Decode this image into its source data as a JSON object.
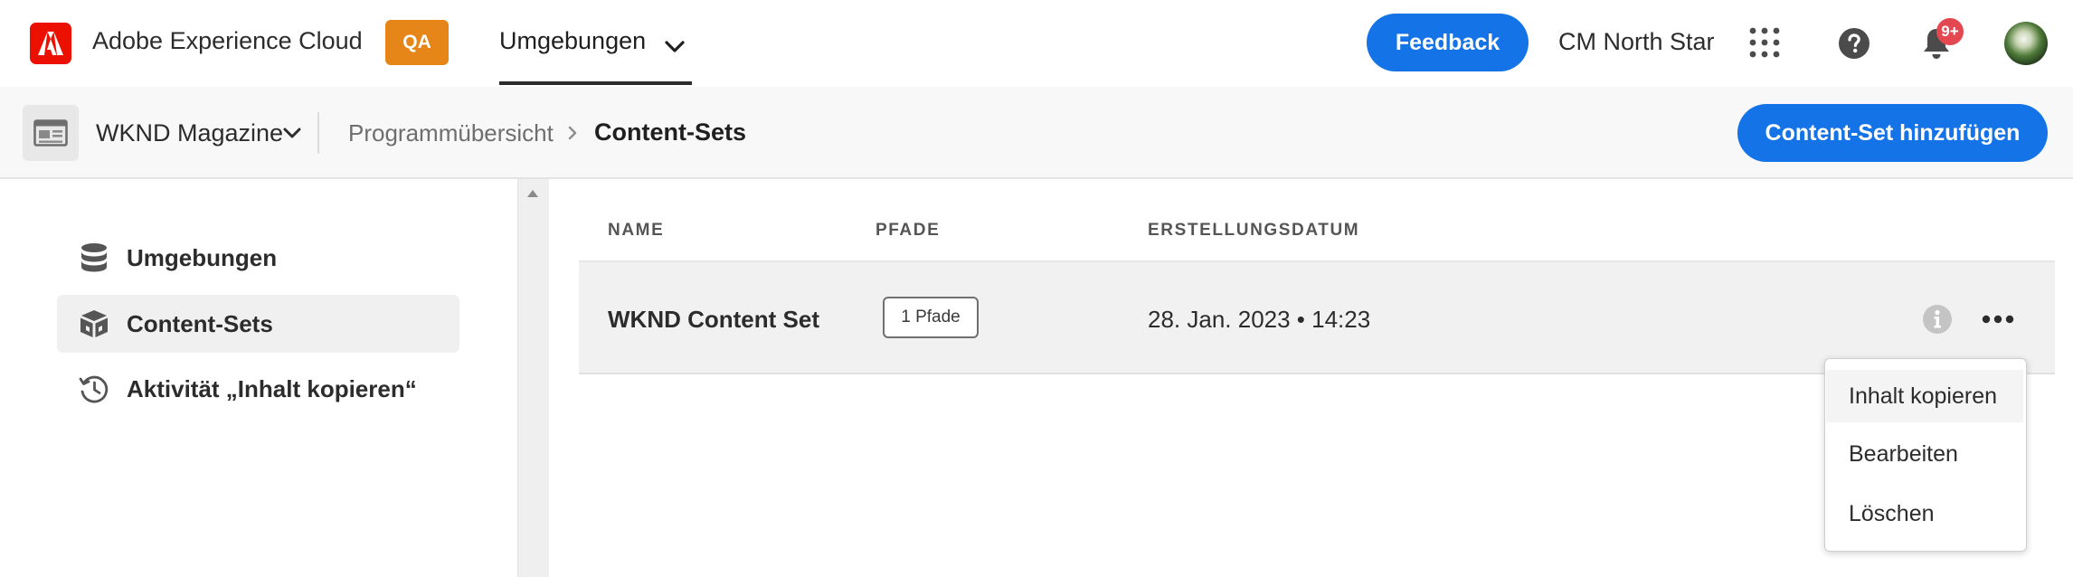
{
  "colors": {
    "adobe_red": "#eb1000",
    "qa_badge": "#e68619",
    "primary_blue": "#1473e6",
    "notification_red": "#e34850",
    "selected_nav_bg": "#f0f0f0",
    "row_bg": "#f1f1f1"
  },
  "header": {
    "logo_icon": "adobe-logo-icon",
    "app_name": "Adobe Experience Cloud",
    "env_badge": "QA",
    "nav_tab": {
      "label": "Umgebungen",
      "icon": "chevron-down-icon",
      "selected": true
    },
    "feedback_label": "Feedback",
    "org_name": "CM North Star",
    "apps_icon": "apps-grid-icon",
    "help_icon": "help-icon",
    "notifications": {
      "icon": "bell-icon",
      "count": "9+"
    },
    "avatar_icon": "user-avatar"
  },
  "subheader": {
    "program_icon": "program-icon",
    "program_name": "WKND Magazine",
    "breadcrumb": [
      "Programmübersicht",
      "Content-Sets"
    ],
    "add_button_label": "Content-Set hinzufügen"
  },
  "sidebar": {
    "items": [
      {
        "label": "Umgebungen",
        "icon": "database-icon",
        "active": false
      },
      {
        "label": "Content-Sets",
        "icon": "boxes-icon",
        "active": true
      },
      {
        "label": "Aktivität „Inhalt kopieren“",
        "icon": "history-icon",
        "active": false
      }
    ]
  },
  "table": {
    "columns": [
      "NAME",
      "PFADE",
      "ERSTELLUNGSDATUM"
    ],
    "rows": [
      {
        "name": "WKND Content Set",
        "paths": "1 Pfade",
        "created": "28. Jan. 2023 • 14:23"
      }
    ]
  },
  "row_actions": {
    "info_icon": "info-icon",
    "more_icon": "more-icon",
    "menu": [
      "Inhalt kopieren",
      "Bearbeiten",
      "Löschen"
    ]
  }
}
